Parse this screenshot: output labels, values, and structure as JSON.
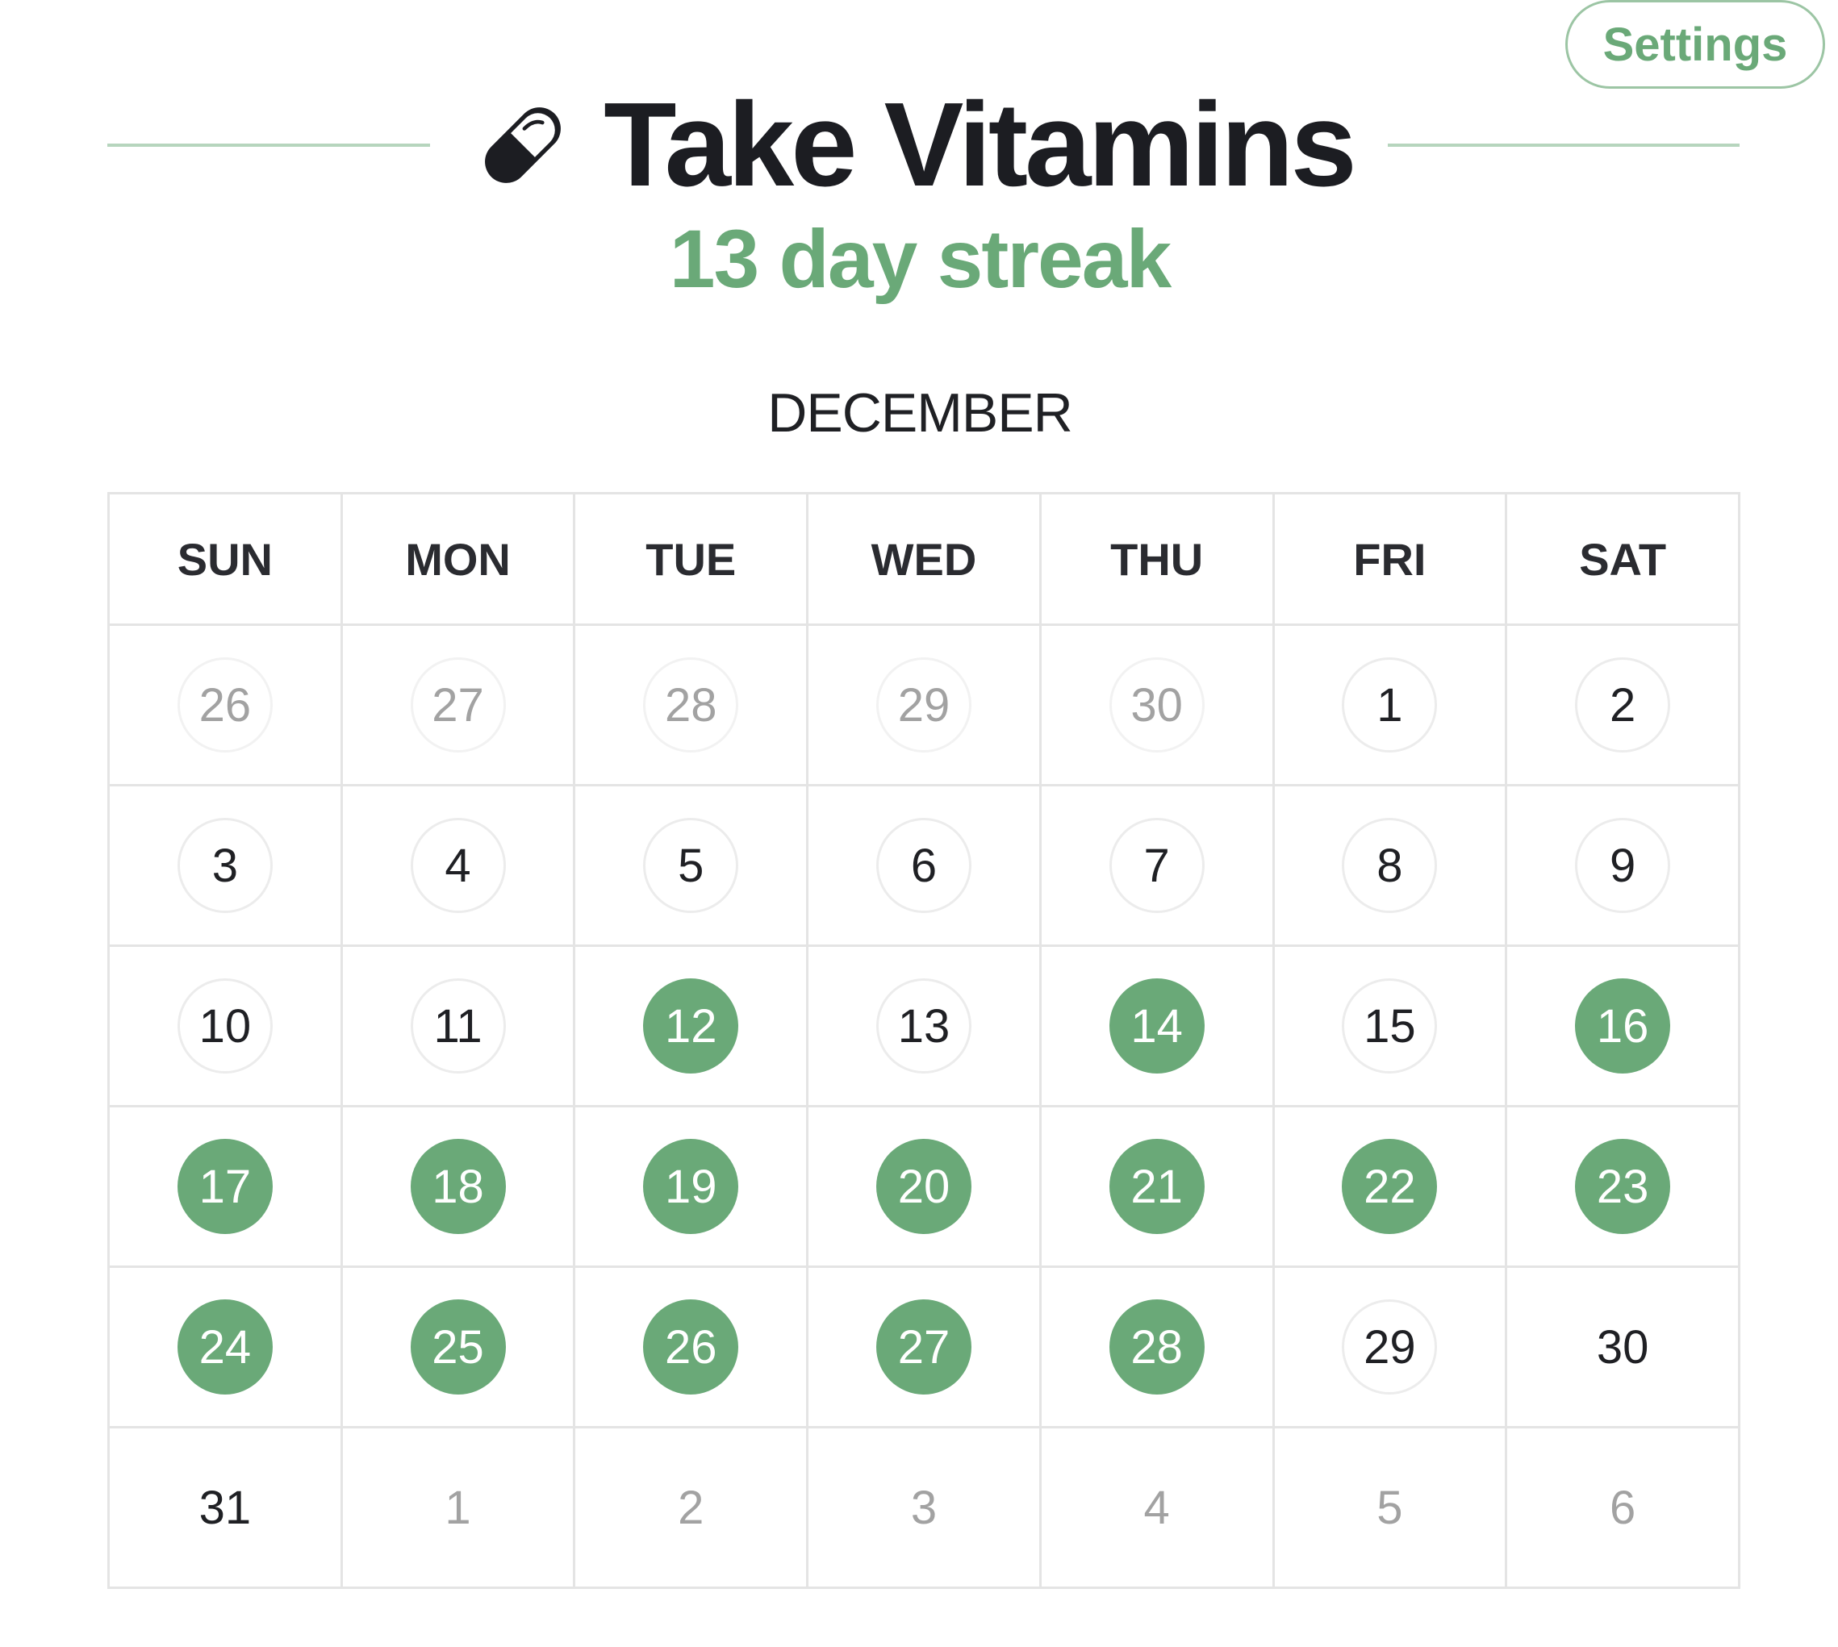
{
  "header": {
    "settings_label": "Settings",
    "title": "Take Vitamins",
    "streak": "13 day streak",
    "icon": "pill-icon"
  },
  "colors": {
    "accent": "#6aa978",
    "text": "#1f2024",
    "muted": "#a2a2a2",
    "grid": "#e4e4e4"
  },
  "calendar": {
    "month": "DECEMBER",
    "weekdays": [
      "SUN",
      "MON",
      "TUE",
      "WED",
      "THU",
      "FRI",
      "SAT"
    ],
    "weeks": [
      [
        {
          "label": "26",
          "state": "outside"
        },
        {
          "label": "27",
          "state": "outside"
        },
        {
          "label": "28",
          "state": "outside"
        },
        {
          "label": "29",
          "state": "outside"
        },
        {
          "label": "30",
          "state": "outside"
        },
        {
          "label": "1",
          "state": "empty"
        },
        {
          "label": "2",
          "state": "empty"
        }
      ],
      [
        {
          "label": "3",
          "state": "empty"
        },
        {
          "label": "4",
          "state": "empty"
        },
        {
          "label": "5",
          "state": "empty"
        },
        {
          "label": "6",
          "state": "empty"
        },
        {
          "label": "7",
          "state": "empty"
        },
        {
          "label": "8",
          "state": "empty"
        },
        {
          "label": "9",
          "state": "empty"
        }
      ],
      [
        {
          "label": "10",
          "state": "empty"
        },
        {
          "label": "11",
          "state": "empty"
        },
        {
          "label": "12",
          "state": "done"
        },
        {
          "label": "13",
          "state": "empty"
        },
        {
          "label": "14",
          "state": "done"
        },
        {
          "label": "15",
          "state": "empty"
        },
        {
          "label": "16",
          "state": "done"
        }
      ],
      [
        {
          "label": "17",
          "state": "done"
        },
        {
          "label": "18",
          "state": "done"
        },
        {
          "label": "19",
          "state": "done"
        },
        {
          "label": "20",
          "state": "done"
        },
        {
          "label": "21",
          "state": "done"
        },
        {
          "label": "22",
          "state": "done"
        },
        {
          "label": "23",
          "state": "done"
        }
      ],
      [
        {
          "label": "24",
          "state": "done"
        },
        {
          "label": "25",
          "state": "done"
        },
        {
          "label": "26",
          "state": "done"
        },
        {
          "label": "27",
          "state": "done"
        },
        {
          "label": "28",
          "state": "done"
        },
        {
          "label": "29",
          "state": "empty"
        },
        {
          "label": "30",
          "state": "future"
        }
      ],
      [
        {
          "label": "31",
          "state": "future"
        },
        {
          "label": "1",
          "state": "outside-future"
        },
        {
          "label": "2",
          "state": "outside-future"
        },
        {
          "label": "3",
          "state": "outside-future"
        },
        {
          "label": "4",
          "state": "outside-future"
        },
        {
          "label": "5",
          "state": "outside-future"
        },
        {
          "label": "6",
          "state": "outside-future"
        }
      ]
    ]
  }
}
